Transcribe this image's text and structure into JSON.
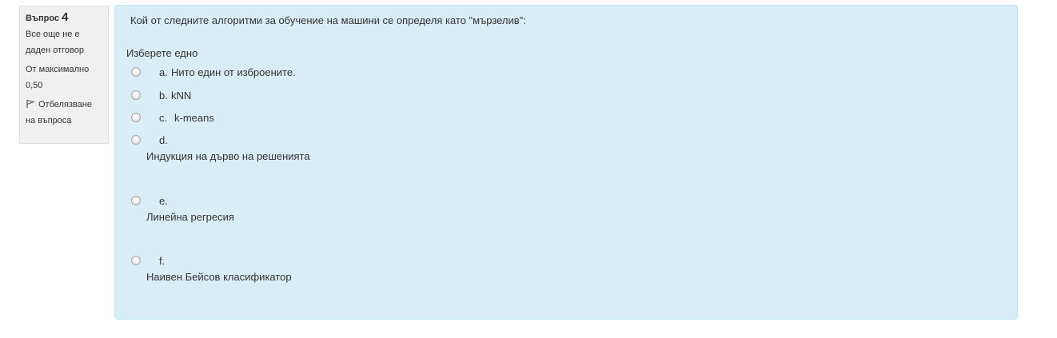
{
  "info": {
    "question_label": "Въпрос",
    "question_number": "4",
    "state": "Все още не е даден отговор",
    "grade": "От максимално 0,50",
    "flag_label": "Отбелязване на въпроса"
  },
  "question": {
    "text": "Кой от следните алгоритми за обучение на машини се определя като \"мързелив\":",
    "prompt": "Изберете едно",
    "options": [
      {
        "letter": "a.",
        "text": "Нито един от изброените."
      },
      {
        "letter": "b.",
        "text": "kNN"
      },
      {
        "letter": "c.",
        "text": "k-means"
      },
      {
        "letter": "d.",
        "text": "Индукция на дърво на решенията"
      },
      {
        "letter": "e.",
        "text": "Линейна регресия"
      },
      {
        "letter": "f.",
        "text": "Наивен Бейсов класификатор"
      }
    ]
  }
}
